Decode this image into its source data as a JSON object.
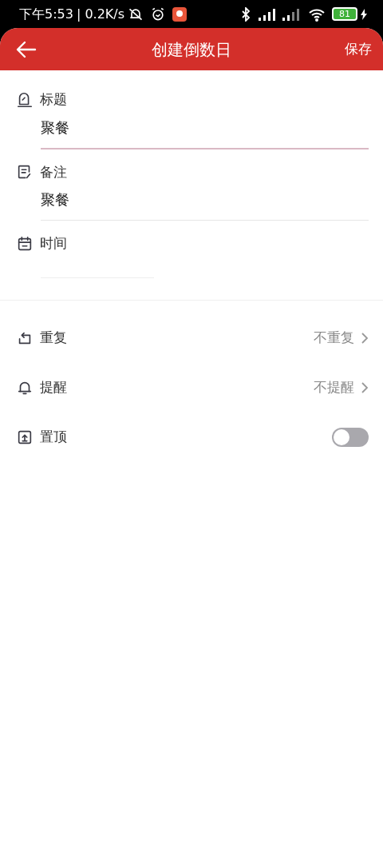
{
  "status_bar": {
    "time": "下午5:53",
    "speed": "| 0.2K/s",
    "battery": "81"
  },
  "header": {
    "title": "创建倒数日",
    "action": "保存"
  },
  "fields": [
    {
      "label": "标题",
      "value": "聚餐",
      "focused": true
    },
    {
      "label": "备注",
      "value": "聚餐",
      "focused": false
    },
    {
      "label": "时间",
      "focused": false
    }
  ],
  "settings": [
    {
      "kind": "select",
      "label": "重复",
      "value": "不重复"
    },
    {
      "kind": "select",
      "label": "提醒",
      "value": "不提醒"
    },
    {
      "kind": "switch",
      "label": "置顶",
      "on": false
    }
  ]
}
